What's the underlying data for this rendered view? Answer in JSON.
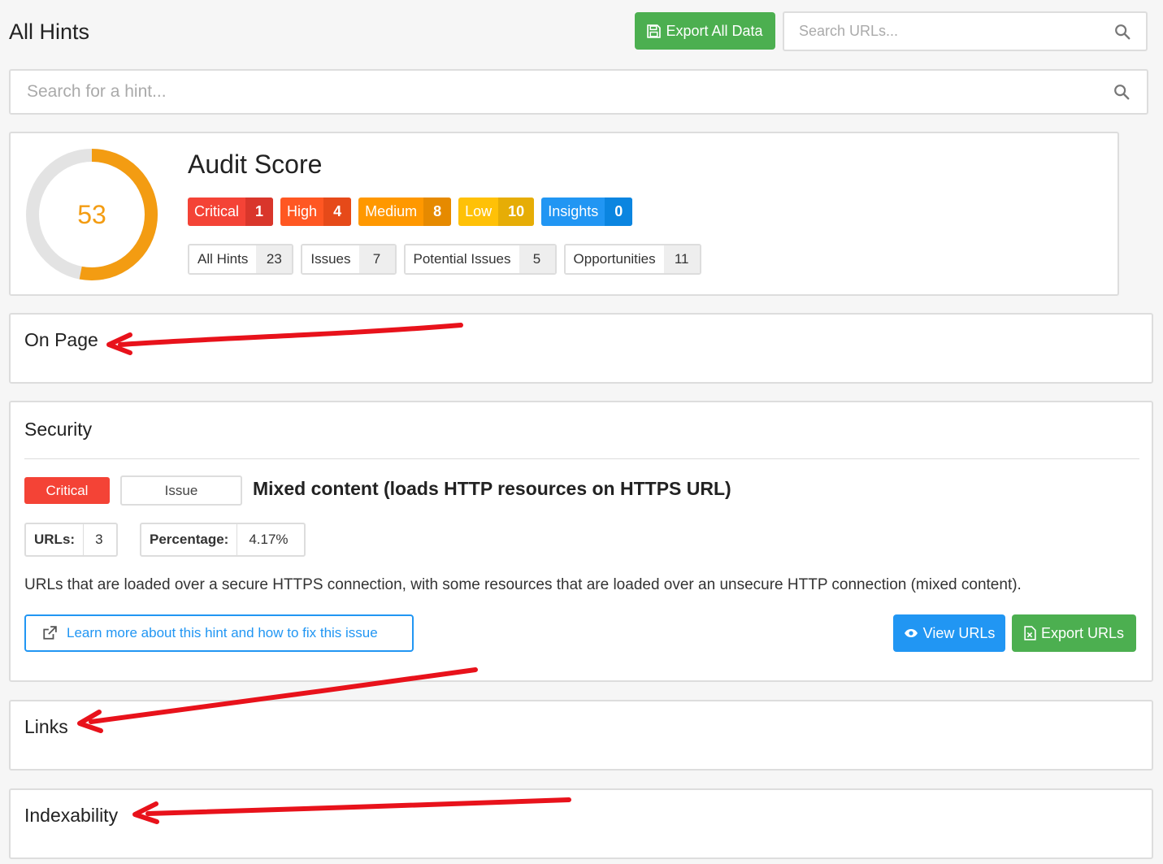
{
  "header": {
    "title": "All Hints",
    "export_all_label": "Export All Data",
    "url_search_placeholder": "Search URLs..."
  },
  "hint_search": {
    "placeholder": "Search for a hint..."
  },
  "audit": {
    "title": "Audit Score",
    "score": "53",
    "score_fraction": 0.53,
    "score_color": "#f39c12",
    "severity_badges": [
      {
        "label": "Critical",
        "count": "1",
        "color": "#f44336",
        "count_color": "#d9362b"
      },
      {
        "label": "High",
        "count": "4",
        "color": "#ff5722",
        "count_color": "#e64a19"
      },
      {
        "label": "Medium",
        "count": "8",
        "color": "#ff9800",
        "count_color": "#e68a00"
      },
      {
        "label": "Low",
        "count": "10",
        "color": "#ffc107",
        "count_color": "#e6ad06"
      },
      {
        "label": "Insights",
        "count": "0",
        "color": "#2196f3",
        "count_color": "#0b85e0"
      }
    ],
    "type_badges": [
      {
        "label": "All Hints",
        "count": "23"
      },
      {
        "label": "Issues",
        "count": "7"
      },
      {
        "label": "Potential Issues",
        "count": "5"
      },
      {
        "label": "Opportunities",
        "count": "11"
      }
    ]
  },
  "sections": {
    "on_page": "On Page",
    "security": "Security",
    "links": "Links",
    "indexability": "Indexability"
  },
  "hint": {
    "severity": "Critical",
    "type": "Issue",
    "title": "Mixed content (loads HTTP resources on HTTPS URL)",
    "urls_label": "URLs:",
    "urls_value": "3",
    "percentage_label": "Percentage:",
    "percentage_value": "4.17%",
    "description": "URLs that are loaded over a secure HTTPS connection, with some resources that are loaded over an unsecure HTTP connection (mixed content).",
    "learn_more": "Learn more about this hint and how to fix this issue",
    "view_urls": "View URLs",
    "export_urls": "Export URLs"
  },
  "colors": {
    "green": "#4caf50",
    "blue": "#2196f3",
    "annotation_arrow": "#e8121b"
  }
}
